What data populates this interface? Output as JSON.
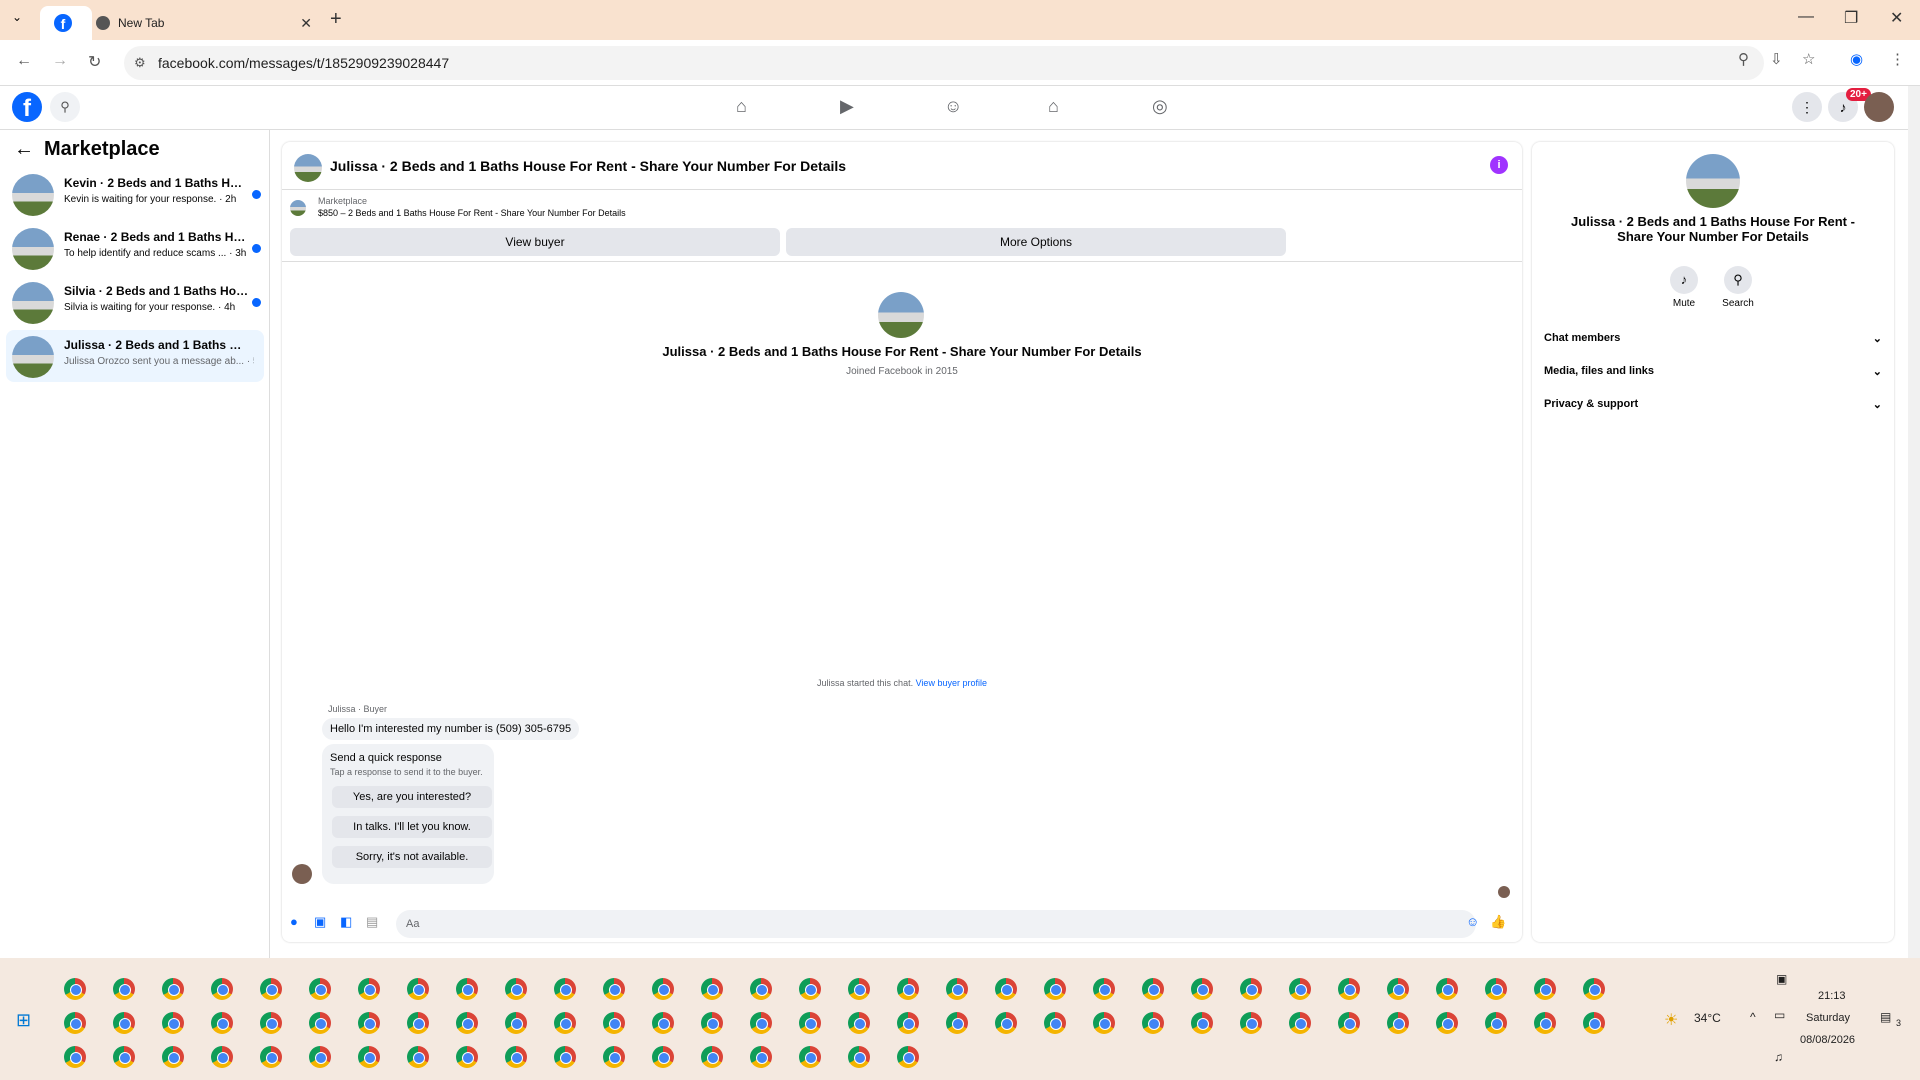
{
  "browser": {
    "active_tab_icon": "facebook-icon",
    "tab_title": "New Tab",
    "url": "facebook.com/messages/t/1852909239028447"
  },
  "left_panel": {
    "title": "Marketplace",
    "conversations": [
      {
        "name": "Kevin · 2 Beds and 1 Baths House...",
        "snippet": "Kevin is waiting for your response. · 2h"
      },
      {
        "name": "Renae · 2 Beds and 1 Baths Hous...",
        "snippet": "To help identify and reduce scams ... · 3h"
      },
      {
        "name": "Silvia · 2 Beds and 1 Baths House...",
        "snippet": "Silvia is waiting for your response. · 4h"
      },
      {
        "name": "Julissa · 2 Beds and 1 Baths House ...",
        "snippet": "Julissa Orozco sent you a message ab... · 5h"
      }
    ]
  },
  "chat": {
    "header_title": "Julissa · 2 Beds and 1 Baths House For Rent - Share Your Number For Details",
    "marketplace_label": "Marketplace",
    "listing": "$850 – 2 Beds and 1 Baths House For Rent - Share Your Number For Details",
    "view_buyer": "View buyer",
    "more_options": "More Options",
    "profile_name": "Julissa · 2 Beds and 1 Baths House For Rent - Share Your Number For Details",
    "profile_sub": "Joined Facebook in 2015",
    "started_text": "Julissa started this chat.",
    "view_buyer_profile": "View buyer profile",
    "sender_label": "Julissa · Buyer",
    "message": "Hello I'm interested my number is (509) 305-6795",
    "quick_response_title": "Send a quick response",
    "quick_response_sub": "Tap a response to send it to the buyer.",
    "quick_responses": [
      "Yes, are you interested?",
      "In talks. I'll let you know.",
      "Sorry, it's not available."
    ],
    "composer_placeholder": "Aa"
  },
  "right_panel": {
    "title": "Julissa · 2 Beds and 1 Baths House For Rent - Share Your Number For Details",
    "mute": "Mute",
    "search": "Search",
    "sections": [
      "Chat members",
      "Media, files and links",
      "Privacy & support"
    ]
  },
  "fb_topbar": {
    "notification_badge": "20+"
  },
  "taskbar": {
    "weather": "34°C",
    "time": "21:13",
    "day": "Saturday",
    "date": "08/08/2026",
    "notif_count": "3"
  }
}
